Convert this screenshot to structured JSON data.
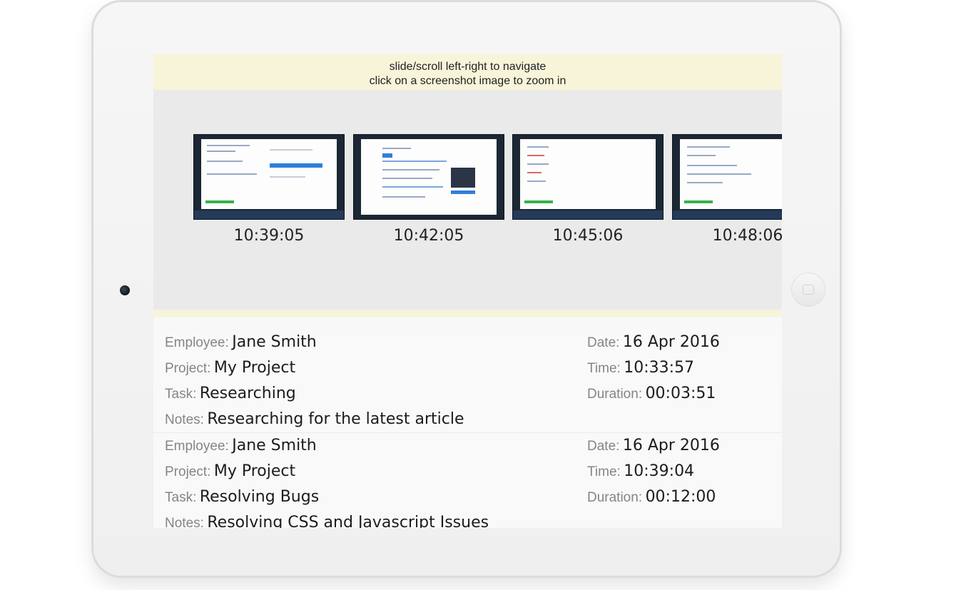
{
  "hint": {
    "line1": "slide/scroll left-right to navigate",
    "line2": "click on a screenshot image to zoom in"
  },
  "screenshots": [
    {
      "time": "10:39:05"
    },
    {
      "time": "10:42:05"
    },
    {
      "time": "10:45:06"
    },
    {
      "time": "10:48:06"
    }
  ],
  "labels": {
    "employee": "Employee:",
    "project": "Project:",
    "task": "Task:",
    "notes": "Notes:",
    "date": "Date:",
    "time": "Time:",
    "duration": "Duration:"
  },
  "records": [
    {
      "employee": "Jane Smith",
      "project": "My Project",
      "task": "Researching",
      "notes": "Researching for the latest article",
      "date": "16 Apr 2016",
      "time": "10:33:57",
      "duration": "00:03:51"
    },
    {
      "employee": "Jane Smith",
      "project": "My Project",
      "task": "Resolving Bugs",
      "notes": "Resolving CSS and Javascript Issues",
      "date": "16 Apr 2016",
      "time": "10:39:04",
      "duration": "00:12:00"
    }
  ],
  "colors": {
    "hint_background": "#f7f4d9",
    "gallery_background": "#eaeaea",
    "taskbar": "#243a59",
    "accent_green": "#36b24a",
    "accent_blue": "#2f7fd8"
  }
}
